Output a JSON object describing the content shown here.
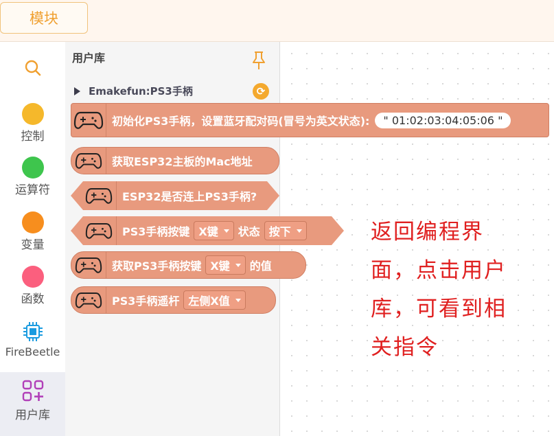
{
  "header": {
    "module_tab": "模块"
  },
  "categories": [
    {
      "label": "",
      "icon": "search-icon"
    },
    {
      "label": "控制",
      "color": "#f5b82b"
    },
    {
      "label": "运算符",
      "color": "#3ec54d"
    },
    {
      "label": "变量",
      "color": "#f78e1e"
    },
    {
      "label": "函数",
      "color": "#fb5f7e"
    },
    {
      "label": "FireBeetle",
      "icon": "chip-icon"
    },
    {
      "label": "用户库",
      "icon": "user-library-icon"
    }
  ],
  "flyout": {
    "title": "用户库",
    "extension_name": "Emakefun:PS3手柄",
    "blocks": [
      {
        "text": "初始化PS3手柄，设置蓝牙配对码(冒号为英文状态):",
        "value": "\" 01:02:03:04:05:06 \""
      },
      {
        "text": "获取ESP32主板的Mac地址"
      },
      {
        "text": "ESP32是否连上PS3手柄?"
      },
      {
        "text_a": "PS3手柄按键",
        "dropdown_a": "X键",
        "text_b": "状态",
        "dropdown_b": "按下"
      },
      {
        "text_a": "获取PS3手柄按键",
        "dropdown_a": "X键",
        "text_b": "的值"
      },
      {
        "text_a": "PS3手柄遥杆",
        "dropdown_a": "左侧X值"
      }
    ]
  },
  "annotation": {
    "text": "返回编程界面，点击用户库，可看到相关指令",
    "color": "#e02020"
  },
  "colors": {
    "block": "#e89a7e",
    "accent": "#f0a030"
  }
}
